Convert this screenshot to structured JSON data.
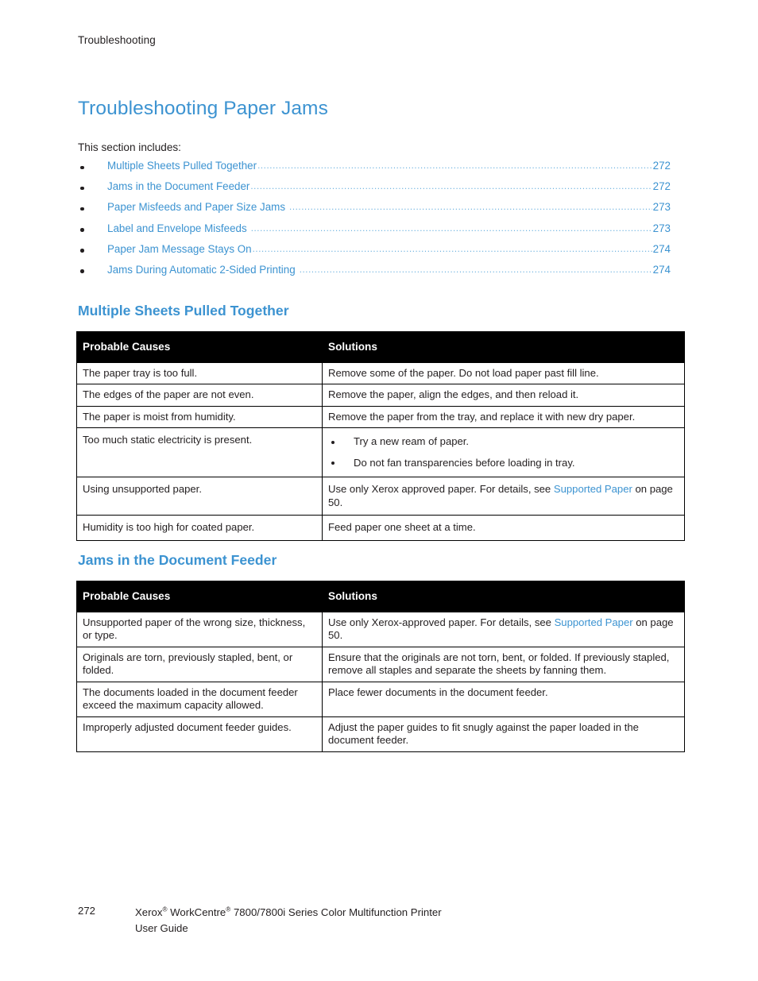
{
  "running_header": "Troubleshooting",
  "page_title": "Troubleshooting Paper Jams",
  "intro": "This section includes:",
  "colors": {
    "link_blue": "#3c93d1",
    "heading_blue": "#3c93d1",
    "table_header_bg": "#000000",
    "text": "#231f20"
  },
  "toc": [
    {
      "label": "Multiple Sheets Pulled Together",
      "page": "272"
    },
    {
      "label": "Jams in the Document Feeder",
      "page": "272"
    },
    {
      "label": "Paper Misfeeds and Paper Size Jams",
      "page": "273"
    },
    {
      "label": "Label and Envelope Misfeeds",
      "page": "273"
    },
    {
      "label": "Paper Jam Message Stays On",
      "page": "274"
    },
    {
      "label": "Jams During Automatic 2-Sided Printing",
      "page": "274"
    }
  ],
  "sections": [
    {
      "heading": "Multiple Sheets Pulled Together",
      "table": {
        "columns": [
          "Probable Causes",
          "Solutions"
        ],
        "rows": [
          {
            "cause": "The paper tray is too full.",
            "solution": "Remove some of the paper. Do not load paper past fill line."
          },
          {
            "cause": "The edges of the paper are not even.",
            "solution": "Remove the paper, align the edges, and then reload it."
          },
          {
            "cause": "The paper is moist from humidity.",
            "solution": "Remove the paper from the tray, and replace it with new dry paper."
          },
          {
            "cause": "Too much static electricity is present.",
            "solution_list": [
              "Try a new ream of paper.",
              "Do not fan transparencies before loading in tray."
            ]
          },
          {
            "cause": "Using unsupported paper.",
            "solution_pre": "Use only Xerox approved paper. For details, see ",
            "solution_link": "Supported Paper",
            "solution_post": " on page 50."
          },
          {
            "cause": "Humidity is too high for coated paper.",
            "solution": "Feed paper one sheet at a time."
          }
        ]
      }
    },
    {
      "heading": "Jams in the Document Feeder",
      "table": {
        "columns": [
          "Probable Causes",
          "Solutions"
        ],
        "rows": [
          {
            "cause": "Unsupported paper of the wrong size, thickness, or type.",
            "solution_pre": "Use only Xerox-approved paper. For details, see ",
            "solution_link": "Supported Paper",
            "solution_post": " on page 50."
          },
          {
            "cause": "Originals are torn, previously stapled, bent, or folded.",
            "solution": "Ensure that the originals are not torn, bent, or folded. If previously stapled, remove all staples and separate the sheets by fanning them."
          },
          {
            "cause": "The documents loaded in the document feeder exceed the maximum capacity allowed.",
            "solution": "Place fewer documents in the document feeder."
          },
          {
            "cause": "Improperly adjusted document feeder guides.",
            "solution": "Adjust the paper guides to fit snugly against the paper loaded in the document feeder."
          }
        ]
      }
    }
  ],
  "footer": {
    "page_number": "272",
    "product_pre": "Xerox",
    "product_mid": " WorkCentre",
    "product_post": " 7800/7800i Series Color Multifunction Printer",
    "registered_mark": "®",
    "guide": "User Guide"
  }
}
